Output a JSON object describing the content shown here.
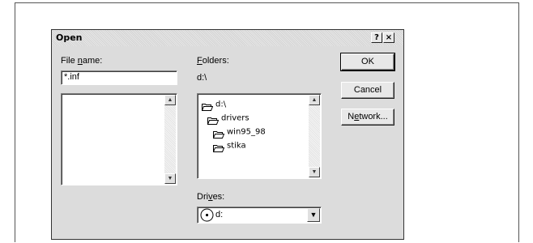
{
  "dialog": {
    "title": "Open",
    "help_button": "?",
    "close_button": "×"
  },
  "file_name": {
    "label_prefix": "File ",
    "label_accel": "n",
    "label_suffix": "ame:",
    "value": "*.inf"
  },
  "folders": {
    "label_accel": "F",
    "label_suffix": "olders:",
    "current_path": "d:\\",
    "items": [
      {
        "label": "d:\\",
        "icon": "open-folder-icon",
        "level": 0
      },
      {
        "label": "drivers",
        "icon": "open-folder-icon",
        "level": 1
      },
      {
        "label": "win95_98",
        "icon": "open-folder-icon",
        "level": 2
      },
      {
        "label": "stika",
        "icon": "open-folder-icon",
        "level": 2
      }
    ]
  },
  "drives": {
    "label_prefix": "Dri",
    "label_accel": "v",
    "label_suffix": "es:",
    "selected": "d:",
    "icon": "cd-drive-icon"
  },
  "buttons": {
    "ok": "OK",
    "cancel": "Cancel",
    "network_prefix": "N",
    "network_accel": "e",
    "network_suffix": "twork..."
  }
}
